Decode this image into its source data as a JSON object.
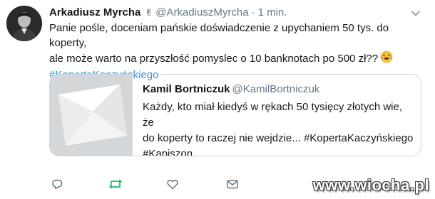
{
  "tweet": {
    "author": {
      "display_name": "Arkadiusz Myrcha",
      "badge_emoji": "✌",
      "handle": "@ArkadiuszMyrcha",
      "separator": "·",
      "time": "1 min."
    },
    "text_line1": "Panie pośle, doceniam pańskie doświadczenie z upychaniem 50 tys. do koperty,",
    "text_line2": "ale może warto na przyszłość pomyslec o 10 banknotach po 500 zł??",
    "text_emoji": "🤣",
    "hashtag": "#KopertaKaczyńskiego",
    "quoted": {
      "display_name": "Kamil Bortniczuk",
      "handle": "@KamilBortniczuk",
      "line1": "Każdy, kto miał kiedyś w rękach 50 tysięcy złotych wie, że",
      "line2_text": "do koperty to raczej nie wejdzie... ",
      "line2_hashtag": "#KopertaKaczyńskiego",
      "line3_hashtag": "#Kapiszon"
    },
    "actions": [
      "reply-icon",
      "retweet-icon",
      "like-icon",
      "direct-message-icon"
    ],
    "colors": {
      "link": "#1b95e0",
      "muted": "#657786",
      "retweet": "#17bf63"
    }
  },
  "watermark": {
    "text": "www.wiocha.pl"
  }
}
